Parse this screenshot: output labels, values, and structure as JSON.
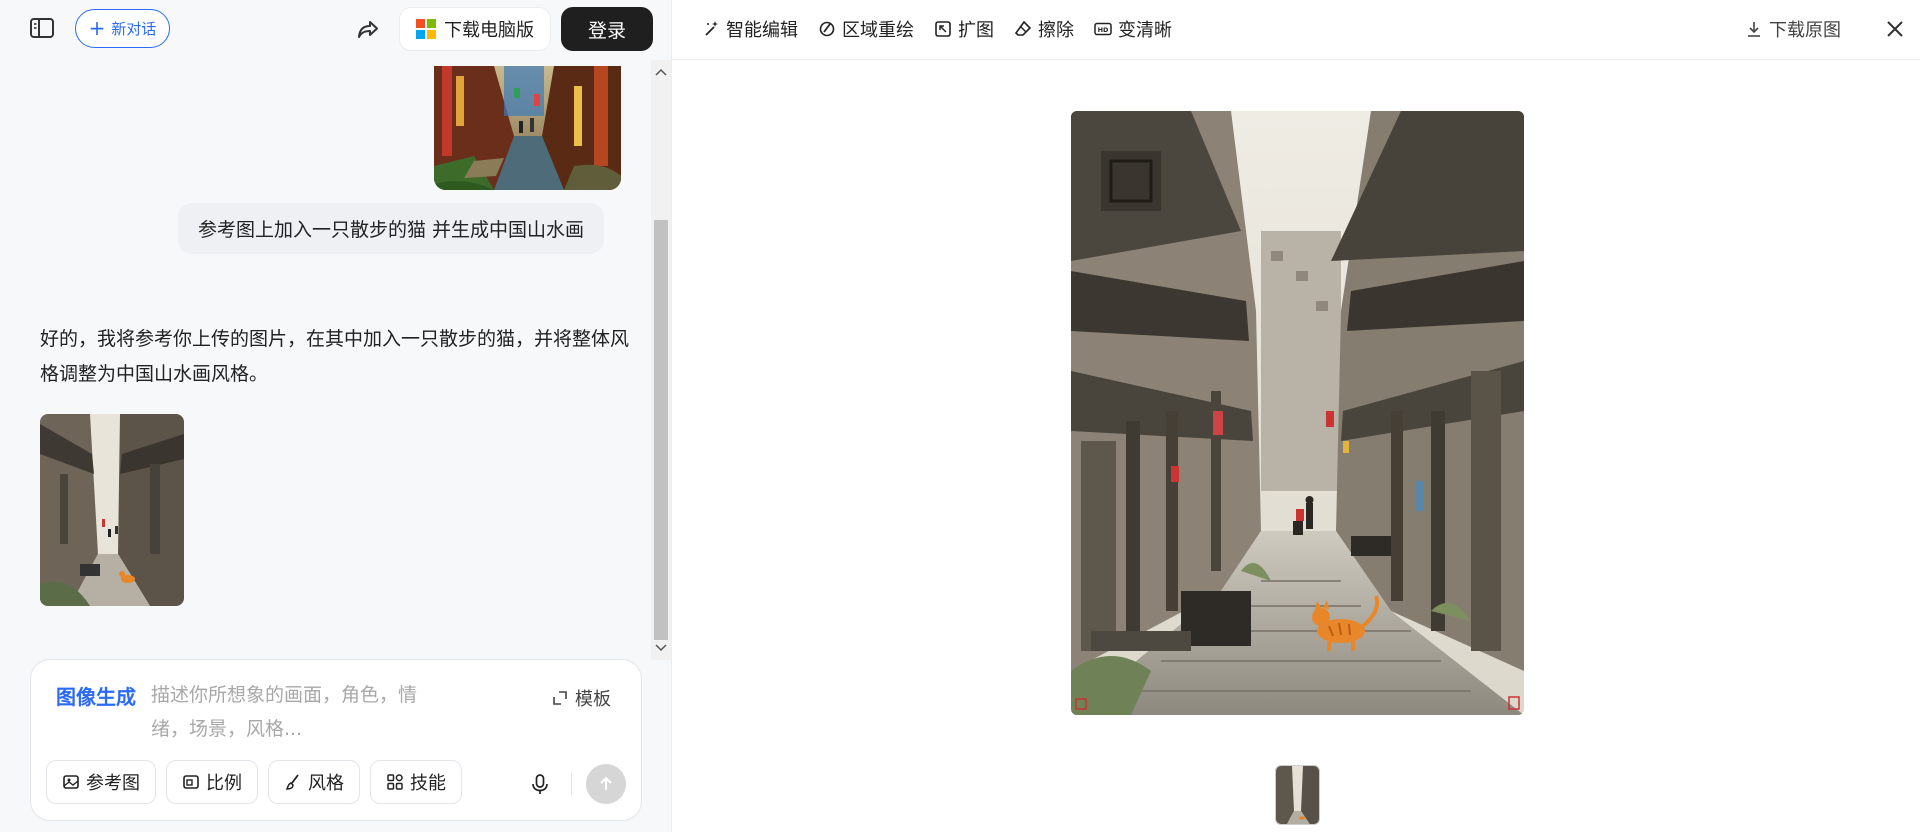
{
  "header": {
    "new_chat_label": "新对话",
    "download_pc_label": "下载电脑版",
    "login_label": "登录"
  },
  "chat": {
    "user_message": "参考图上加入一只散步的猫 并生成中国山水画",
    "ai_reply": "好的，我将参考你上传的图片，在其中加入一只散步的猫，并将整体风格调整为中国山水画风格。"
  },
  "composer": {
    "mode_label": "图像生成",
    "placeholder": "描述你所想象的画面，角色，情绪，场景，风格...",
    "template_label": "模板",
    "tools": [
      {
        "label": "参考图",
        "icon": "image-icon"
      },
      {
        "label": "比例",
        "icon": "ratio-icon"
      },
      {
        "label": "风格",
        "icon": "brush-icon"
      },
      {
        "label": "技能",
        "icon": "grid-icon"
      }
    ]
  },
  "viewer": {
    "tools": [
      {
        "label": "智能编辑",
        "icon": "magic-wand-icon"
      },
      {
        "label": "区域重绘",
        "icon": "region-repaint-icon"
      },
      {
        "label": "扩图",
        "icon": "expand-icon"
      },
      {
        "label": "擦除",
        "icon": "eraser-icon"
      },
      {
        "label": "变清晰",
        "icon": "hd-icon"
      }
    ],
    "download_original_label": "下载原图"
  },
  "colors": {
    "accent": "#2b6af6",
    "login_bg": "#1f1f1f",
    "panel_bg": "#f7f8fa",
    "cat_orange": "#e8862a"
  }
}
